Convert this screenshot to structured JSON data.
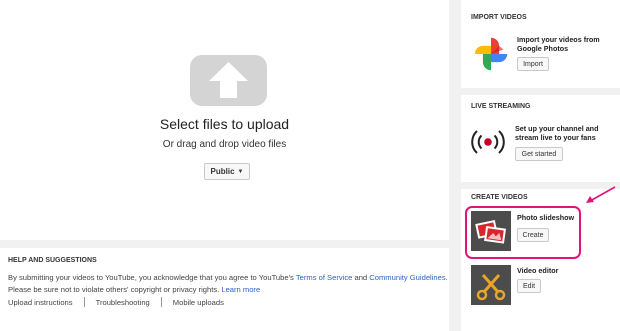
{
  "upload": {
    "title": "Select files to upload",
    "subtitle": "Or drag and drop video files",
    "privacy": "Public"
  },
  "help": {
    "title": "HELP AND SUGGESTIONS",
    "line1_a": "By submitting your videos to YouTube, you acknowledge that you agree to YouTube's ",
    "tos": "Terms of Service",
    "line1_b": " and ",
    "guidelines": "Community Guidelines",
    "line1_c": ".",
    "line2_a": "Please be sure not to violate others' copyright or privacy rights. ",
    "learn_more": "Learn more",
    "links": [
      "Upload instructions",
      "Troubleshooting",
      "Mobile uploads"
    ]
  },
  "sidebar": {
    "import": {
      "title": "IMPORT VIDEOS",
      "text": "Import your videos from Google Photos",
      "button": "Import"
    },
    "live": {
      "title": "LIVE STREAMING",
      "text": "Set up your channel and stream live to your fans",
      "button": "Get started"
    },
    "create": {
      "title": "CREATE VIDEOS",
      "slideshow_label": "Photo slideshow",
      "slideshow_button": "Create",
      "editor_label": "Video editor",
      "editor_button": "Edit"
    }
  },
  "colors": {
    "link": "#2f63c0",
    "highlight": "#e0157c",
    "live_red": "#c4002a"
  }
}
